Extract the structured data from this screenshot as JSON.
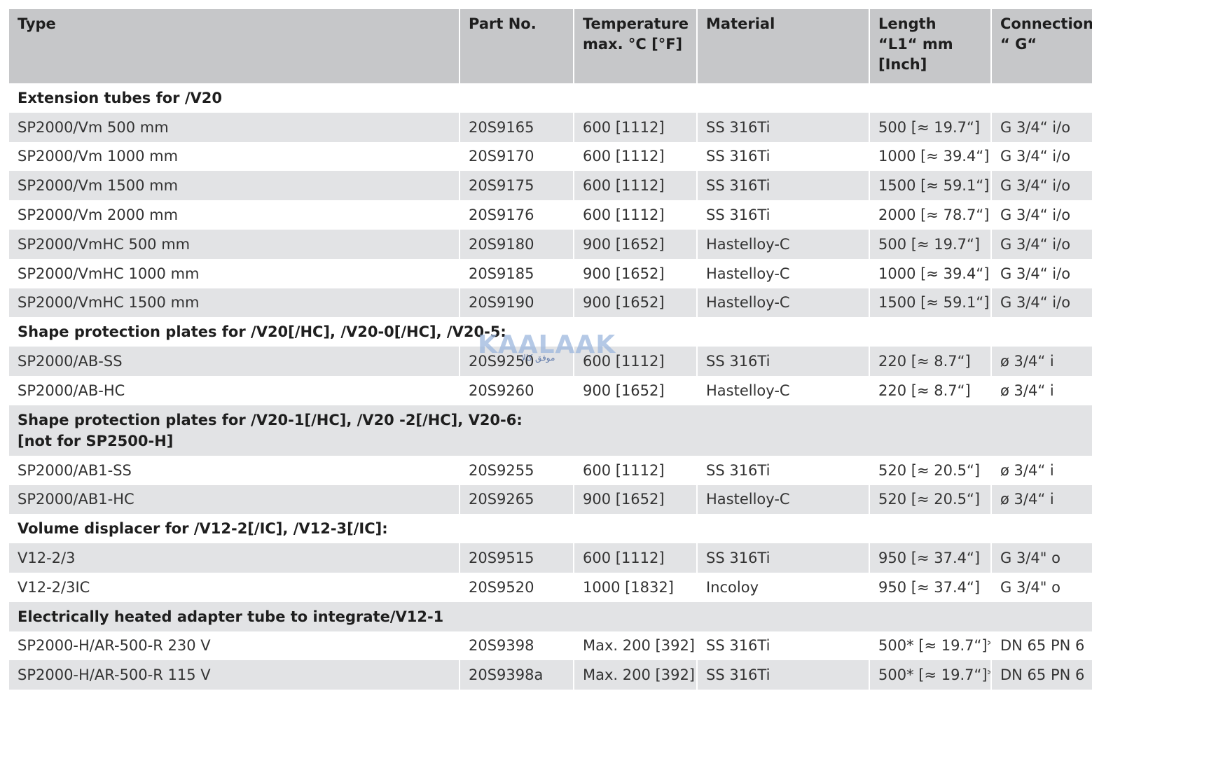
{
  "headers": {
    "type": "Type",
    "part_no": "Part No.",
    "temperature_line1": "Temperature",
    "temperature_line2": "max. °C [°F]",
    "material": "Material",
    "length_line1": "Length",
    "length_line2": "“L1“ mm",
    "length_line3": "[Inch]",
    "connection_line1": "Connection",
    "connection_line2": "“ G“"
  },
  "sections": [
    {
      "title": "Extension tubes for /V20",
      "rows": [
        {
          "type": "SP2000/Vm 500 mm",
          "part_no": "20S9165",
          "temp": "600 [1112]",
          "material": "SS 316Ti",
          "length": "500 [≈ 19.7“]",
          "connection": "G 3/4“ i/o"
        },
        {
          "type": "SP2000/Vm 1000 mm",
          "part_no": "20S9170",
          "temp": "600 [1112]",
          "material": "SS 316Ti",
          "length": "1000 [≈ 39.4“]",
          "connection": "G 3/4“ i/o"
        },
        {
          "type": "SP2000/Vm 1500 mm",
          "part_no": "20S9175",
          "temp": "600 [1112]",
          "material": "SS 316Ti",
          "length": "1500 [≈ 59.1“]",
          "connection": "G 3/4“ i/o"
        },
        {
          "type": "SP2000/Vm 2000 mm",
          "part_no": "20S9176",
          "temp": "600 [1112]",
          "material": "SS 316Ti",
          "length": "2000 [≈ 78.7“]",
          "connection": "G 3/4“ i/o"
        },
        {
          "type": "SP2000/VmHC 500 mm",
          "part_no": "20S9180",
          "temp": "900 [1652]",
          "material": "Hastelloy-C",
          "length": "500 [≈ 19.7“]",
          "connection": "G 3/4“ i/o"
        },
        {
          "type": "SP2000/VmHC 1000 mm",
          "part_no": "20S9185",
          "temp": "900 [1652]",
          "material": "Hastelloy-C",
          "length": "1000 [≈ 39.4“]",
          "connection": "G 3/4“ i/o"
        },
        {
          "type": "SP2000/VmHC 1500 mm",
          "part_no": "20S9190",
          "temp": "900 [1652]",
          "material": "Hastelloy-C",
          "length": "1500 [≈ 59.1“]",
          "connection": "G 3/4“ i/o"
        }
      ]
    },
    {
      "title": "Shape protection plates for /V20[/HC], /V20-0[/HC], /V20-5:",
      "rows": [
        {
          "type": "SP2000/AB-SS",
          "part_no": "20S9250",
          "temp": "600 [1112]",
          "material": "SS 316Ti",
          "length": "220 [≈ 8.7“]",
          "connection": "ø 3/4“ i"
        },
        {
          "type": "SP2000/AB-HC",
          "part_no": "20S9260",
          "temp": "900 [1652]",
          "material": "Hastelloy-C",
          "length": "220 [≈ 8.7“]",
          "connection": "ø 3/4“ i"
        }
      ]
    },
    {
      "title_line1": "Shape protection plates for /V20-1[/HC], /V20 -2[/HC], V20-6:",
      "title_line2": "[not for SP2500-H]",
      "rows": [
        {
          "type": "SP2000/AB1-SS",
          "part_no": "20S9255",
          "temp": "600 [1112]",
          "material": "SS 316Ti",
          "length": "520 [≈ 20.5“]",
          "connection": "ø 3/4“ i"
        },
        {
          "type": "SP2000/AB1-HC",
          "part_no": "20S9265",
          "temp": "900 [1652]",
          "material": "Hastelloy-C",
          "length": "520 [≈ 20.5“]",
          "connection": "ø 3/4“ i"
        }
      ]
    },
    {
      "title": "Volume displacer for /V12-2[/IC], /V12-3[/IC]:",
      "rows": [
        {
          "type": "V12-2/3",
          "part_no": "20S9515",
          "temp": "600 [1112]",
          "material": "SS 316Ti",
          "length": "950 [≈ 37.4“]",
          "connection": "G 3/4\" o"
        },
        {
          "type": "V12-2/3IC",
          "part_no": "20S9520",
          "temp": "1000 [1832]",
          "material": "Incoloy",
          "length": "950 [≈ 37.4“]",
          "connection": "G 3/4\" o"
        }
      ]
    },
    {
      "title": "Electrically heated adapter tube to integrate/V12-1",
      "rows": [
        {
          "type": "SP2000-H/AR-500-R 230 V",
          "part_no": "20S9398",
          "temp": "Max. 200 [392]",
          "material": "SS 316Ti",
          "length": "500* [≈ 19.7“]*",
          "connection": "DN 65 PN 6"
        },
        {
          "type": "SP2000-H/AR-500-R 115 V",
          "part_no": "20S9398a",
          "temp": "Max. 200 [392]",
          "material": "SS 316Ti",
          "length": "500* [≈ 19.7“]*",
          "connection": "DN 65 PN 6"
        }
      ]
    }
  ],
  "watermark": {
    "word": "KAALAAK",
    "subtitle": "موفق کالا",
    "color": "#9db8de"
  },
  "colors": {
    "header_bg": "#c6c7c9",
    "row_shaded_bg": "#e2e3e5",
    "row_plain_bg": "#ffffff"
  }
}
